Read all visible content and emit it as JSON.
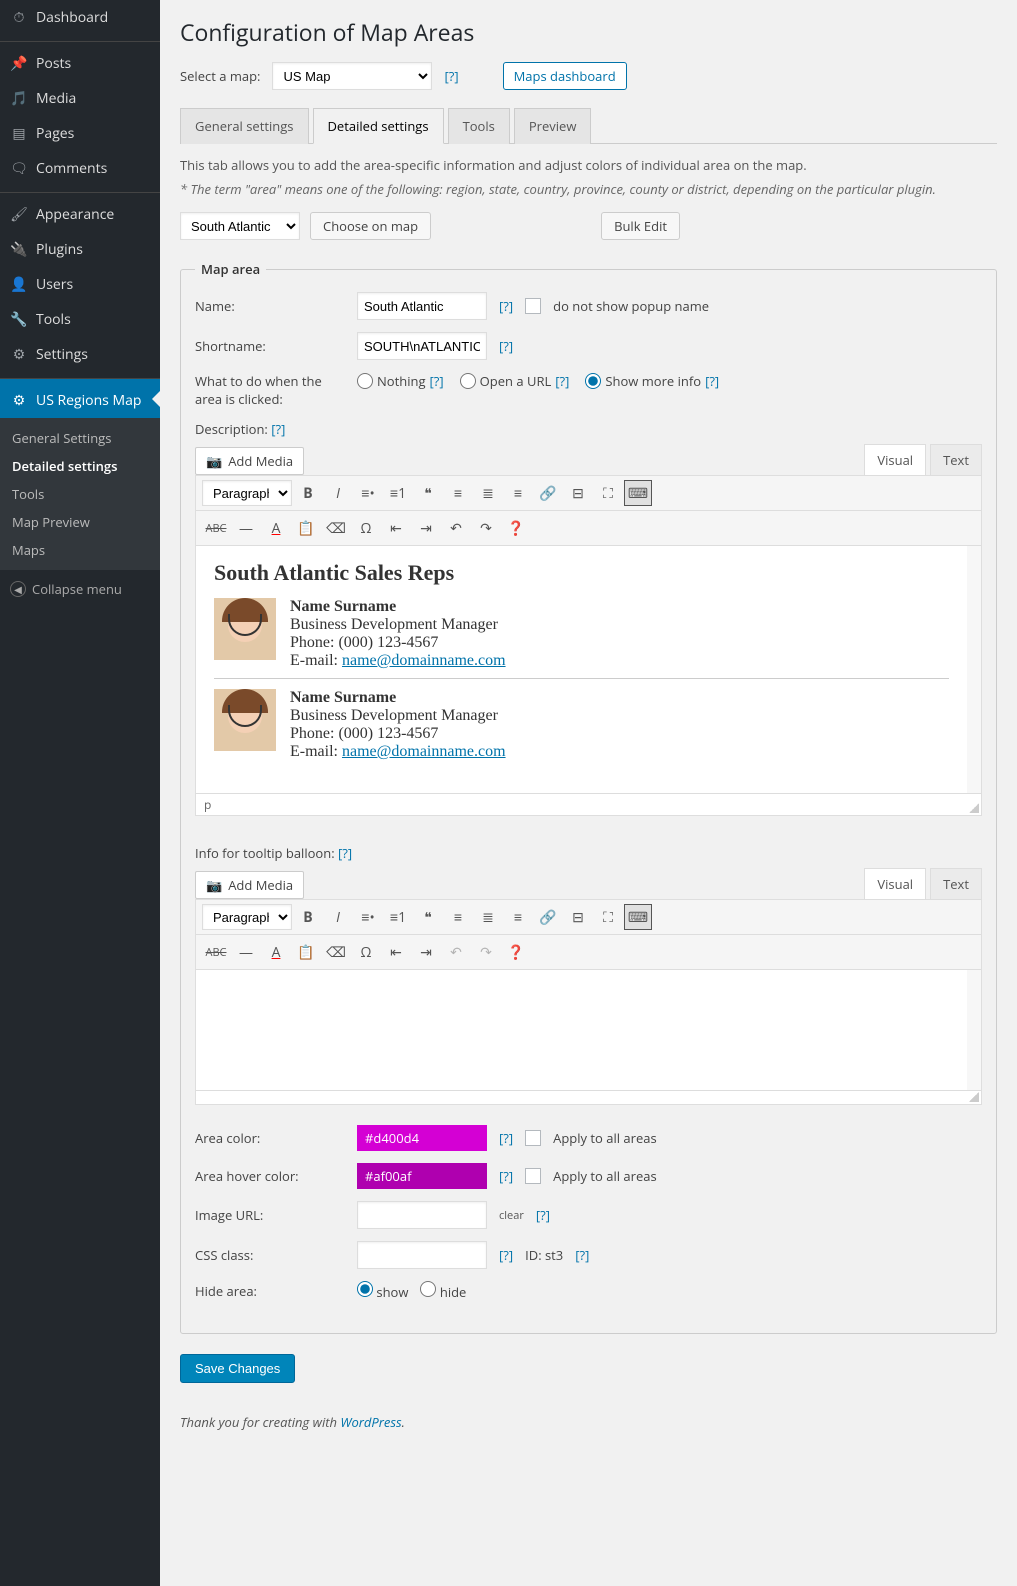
{
  "sidebar": {
    "items": [
      {
        "label": "Dashboard",
        "icon": "⏱"
      },
      {
        "label": "Posts",
        "icon": "📌"
      },
      {
        "label": "Media",
        "icon": "🎵"
      },
      {
        "label": "Pages",
        "icon": "▤"
      },
      {
        "label": "Comments",
        "icon": "🗨"
      },
      {
        "label": "Appearance",
        "icon": "🖌"
      },
      {
        "label": "Plugins",
        "icon": "🔌"
      },
      {
        "label": "Users",
        "icon": "👤"
      },
      {
        "label": "Tools",
        "icon": "🔧"
      },
      {
        "label": "Settings",
        "icon": "⚙"
      },
      {
        "label": "US Regions Map",
        "icon": "⚙"
      }
    ],
    "submenu": [
      "General Settings",
      "Detailed settings",
      "Tools",
      "Map Preview",
      "Maps"
    ],
    "collapse": "Collapse menu"
  },
  "page": {
    "title": "Configuration of Map Areas",
    "select_label": "Select a map:",
    "map": "US Map",
    "help": "[?]",
    "dashboard_btn": "Maps dashboard"
  },
  "tabs": [
    "General settings",
    "Detailed settings",
    "Tools",
    "Preview"
  ],
  "intro": {
    "line1": "This tab allows you to add the area-specific information and adjust colors of individual area on the map.",
    "line2": "* The term \"area\" means one of the following: region, state, country, province, county or district, depending on the particular plugin."
  },
  "area_select": {
    "value": "South Atlantic",
    "choose": "Choose on map",
    "bulk": "Bulk Edit"
  },
  "maparea": {
    "legend": "Map area",
    "name_lbl": "Name:",
    "name": "South Atlantic",
    "noshow": "do not show popup name",
    "short_lbl": "Shortname:",
    "short": "SOUTH\\nATLANTIC",
    "click_lbl": "What to do when the area is clicked:",
    "opt_nothing": "Nothing",
    "opt_url": "Open a URL",
    "opt_more": "Show more info",
    "desc_lbl": "Description:",
    "addmedia": "Add Media",
    "ed_visual": "Visual",
    "ed_text": "Text",
    "paragraph": "Paragraph",
    "content_title": "South Atlantic Sales Reps",
    "person": {
      "name": "Name Surname",
      "role": "Business Development Manager",
      "phone": "Phone: (000) 123-4567",
      "email_pref": "E-mail: ",
      "email": "name@domainname.com"
    },
    "status": "p",
    "tooltip_lbl": "Info for tooltip balloon:",
    "color_lbl": "Area color:",
    "color": "#d400d4",
    "apply": "Apply to all areas",
    "hover_lbl": "Area hover color:",
    "hover": "#af00af",
    "image_lbl": "Image URL:",
    "clear": "clear",
    "css_lbl": "CSS class:",
    "id_txt": "ID: st3",
    "hide_lbl": "Hide area:",
    "show": "show",
    "hide": "hide"
  },
  "save": "Save Changes",
  "footer": {
    "pre": "Thank you for creating with ",
    "link": "WordPress",
    "suf": "."
  }
}
